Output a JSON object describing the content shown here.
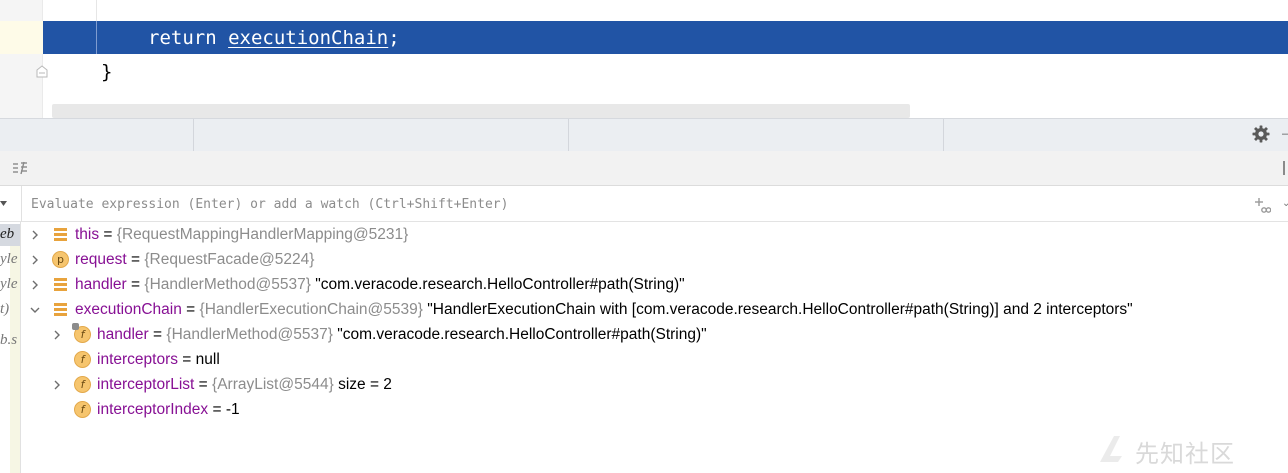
{
  "editor": {
    "current_line": {
      "keyword": "return",
      "identifier": "executionChain",
      "terminator": ";"
    },
    "next_line": "}"
  },
  "evaluate": {
    "placeholder": "Evaluate expression (Enter) or add a watch (Ctrl+Shift+Enter)"
  },
  "frames_fragments": [
    "eb",
    "yle",
    "yle",
    "t)",
    "b.s"
  ],
  "variables": [
    {
      "depth": 0,
      "expandable": true,
      "expanded": false,
      "icon": "stack-icon",
      "name": "this",
      "eq": " = ",
      "type": "{RequestMappingHandlerMapping@5231}",
      "value": ""
    },
    {
      "depth": 0,
      "expandable": true,
      "expanded": false,
      "icon": "p",
      "name": "request",
      "eq": " = ",
      "type": "{RequestFacade@5224}",
      "value": ""
    },
    {
      "depth": 0,
      "expandable": true,
      "expanded": false,
      "icon": "stack-icon",
      "name": "handler",
      "eq": " = ",
      "type": "{HandlerMethod@5537}",
      "value": " \"com.veracode.research.HelloController#path(String)\""
    },
    {
      "depth": 0,
      "expandable": true,
      "expanded": true,
      "icon": "stack-icon",
      "name": "executionChain",
      "eq": " = ",
      "type": "{HandlerExecutionChain@5539}",
      "value": " \"HandlerExecutionChain with [com.veracode.research.HelloController#path(String)] and 2 interceptors\""
    },
    {
      "depth": 1,
      "expandable": true,
      "expanded": false,
      "icon": "f-final",
      "name": "handler",
      "eq": " = ",
      "type": "{HandlerMethod@5537}",
      "value": " \"com.veracode.research.HelloController#path(String)\""
    },
    {
      "depth": 1,
      "expandable": false,
      "expanded": false,
      "icon": "f",
      "name": "interceptors",
      "eq": " = ",
      "type": "",
      "value": "null"
    },
    {
      "depth": 1,
      "expandable": true,
      "expanded": false,
      "icon": "f",
      "name": "interceptorList",
      "eq": " = ",
      "type": "{ArrayList@5544}",
      "value": "  size = 2"
    },
    {
      "depth": 1,
      "expandable": false,
      "expanded": false,
      "icon": "f",
      "name": "interceptorIndex",
      "eq": " = ",
      "type": "",
      "value": "-1"
    }
  ],
  "watermark": {
    "text": "先知社区"
  },
  "colors": {
    "execution_line": "#2154a5",
    "var_name": "#871094",
    "type_grey": "#8c8c8c",
    "field_icon": "#f6c56e"
  }
}
